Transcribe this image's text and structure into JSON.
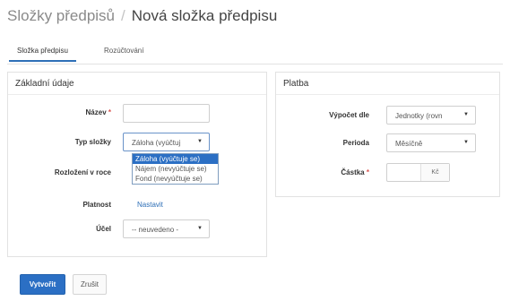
{
  "breadcrumb": {
    "parent": "Složky předpisů",
    "separator": "/",
    "current": "Nová složka předpisu"
  },
  "tabs": [
    {
      "label": "Složka předpisu",
      "active": true
    },
    {
      "label": "Rozúčtování",
      "active": false
    }
  ],
  "basic": {
    "title": "Základní údaje",
    "name": {
      "label": "Název",
      "required_mark": "*",
      "value": ""
    },
    "type": {
      "label": "Typ složky",
      "selected": "Záloha (vyúčtuj",
      "options": [
        "Záloha (vyúčtuje se)",
        "Nájem (nevyúčtuje se)",
        "Fond (nevyúčtuje se)"
      ]
    },
    "distribution": {
      "label": "Rozložení v roce"
    },
    "validity": {
      "label": "Platnost",
      "link": "Nastavit"
    },
    "purpose": {
      "label": "Účel",
      "selected": "-- neuvedeno -"
    }
  },
  "payment": {
    "title": "Platba",
    "calculation": {
      "label": "Výpočet dle",
      "selected": "Jednotky (rovn"
    },
    "period": {
      "label": "Perioda",
      "selected": "Měsíčně"
    },
    "amount": {
      "label": "Částka",
      "required_mark": "*",
      "value": "",
      "currency": "Kč"
    }
  },
  "actions": {
    "create": "Vytvořit",
    "cancel": "Zrušit"
  },
  "colors": {
    "primary": "#2b6fc4",
    "link": "#2e6fb7",
    "required": "#d9534f"
  }
}
